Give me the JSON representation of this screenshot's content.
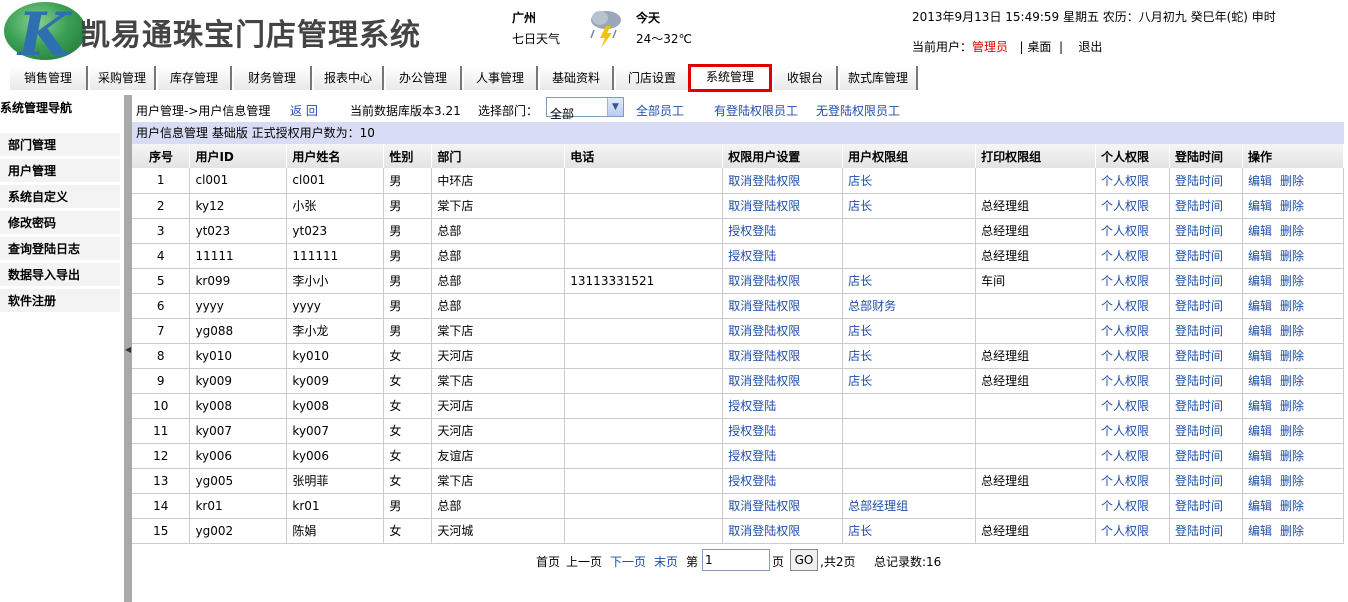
{
  "header": {
    "logo_letter": "K",
    "app_title": "凯易通珠宝门店管理系统",
    "city": "广州",
    "city_sub": "七日天气",
    "weather_icon": "thunderstorm-icon",
    "today_label": "今天",
    "temperature": "24～32℃",
    "datetime": "2013年9月13日  15:49:59 星期五  农历：八月初九  癸巳年(蛇) 申时",
    "current_user_label": "当前用户：",
    "current_user": "管理员",
    "sep1": "|",
    "desktop_link": "桌面",
    "sep2": "|",
    "logout_link": "退出",
    "brand_color": "#2e6fb0",
    "user_color": "#dd0000"
  },
  "nav": {
    "items": [
      {
        "label": "销售管理"
      },
      {
        "label": "采购管理"
      },
      {
        "label": "库存管理"
      },
      {
        "label": "财务管理"
      },
      {
        "label": "报表中心"
      },
      {
        "label": "办公管理"
      },
      {
        "label": "人事管理"
      },
      {
        "label": "基础资料"
      },
      {
        "label": "门店设置"
      },
      {
        "label": "系统管理"
      },
      {
        "label": "收银台"
      },
      {
        "label": "款式库管理"
      }
    ],
    "active_index": 9,
    "active_color": "#e00000"
  },
  "sidebar": {
    "title": "系统管理导航",
    "items": [
      {
        "label": "部门管理"
      },
      {
        "label": "用户管理"
      },
      {
        "label": "系统自定义"
      },
      {
        "label": "修改密码"
      },
      {
        "label": "查询登陆日志"
      },
      {
        "label": "数据导入导出"
      },
      {
        "label": "软件注册"
      }
    ]
  },
  "toolbar": {
    "breadcrumb": "用户管理->用户信息管理",
    "back_link": "返 回",
    "db_version": "当前数据库版本3.21",
    "dept_label": "选择部门：",
    "dept_value": "全部",
    "all_staff": "全部员工",
    "with_login": "有登陆权限员工",
    "without_login": "无登陆权限员工"
  },
  "infobar": {
    "text": "用户信息管理   基础版  正式授权用户数为：10",
    "bg_color": "#d9dcf5"
  },
  "table": {
    "headers": [
      "序号",
      "用户ID",
      "用户姓名",
      "性别",
      "部门",
      "电话",
      "权限用户设置",
      "用户权限组",
      "打印权限组",
      "个人权限",
      "登陆时间",
      "操作"
    ],
    "personal_link": "个人权限",
    "login_link": "登陆时间",
    "edit_link": "编辑",
    "delete_link": "删除",
    "rows": [
      {
        "no": "1",
        "id": "cl001",
        "name": "cl001",
        "gender": "男",
        "dept": "中环店",
        "phone": "",
        "perm": "取消登陆权限",
        "group": "店长",
        "print": ""
      },
      {
        "no": "2",
        "id": "ky12",
        "name": "小张",
        "gender": "男",
        "dept": "棠下店",
        "phone": "",
        "perm": "取消登陆权限",
        "group": "店长",
        "print": "总经理组"
      },
      {
        "no": "3",
        "id": "yt023",
        "name": "yt023",
        "gender": "男",
        "dept": "总部",
        "phone": "",
        "perm": "授权登陆",
        "group": "",
        "print": "总经理组"
      },
      {
        "no": "4",
        "id": "11111",
        "name": "111111",
        "gender": "男",
        "dept": "总部",
        "phone": "",
        "perm": "授权登陆",
        "group": "",
        "print": "总经理组"
      },
      {
        "no": "5",
        "id": "kr099",
        "name": "李小小",
        "gender": "男",
        "dept": "总部",
        "phone": "13113331521",
        "perm": "取消登陆权限",
        "group": "店长",
        "print": "车间"
      },
      {
        "no": "6",
        "id": "yyyy",
        "name": "yyyy",
        "gender": "男",
        "dept": "总部",
        "phone": "",
        "perm": "取消登陆权限",
        "group": "总部财务",
        "print": ""
      },
      {
        "no": "7",
        "id": "yg088",
        "name": "李小龙",
        "gender": "男",
        "dept": "棠下店",
        "phone": "",
        "perm": "取消登陆权限",
        "group": "店长",
        "print": ""
      },
      {
        "no": "8",
        "id": "ky010",
        "name": "ky010",
        "gender": "女",
        "dept": "天河店",
        "phone": "",
        "perm": "取消登陆权限",
        "group": "店长",
        "print": "总经理组"
      },
      {
        "no": "9",
        "id": "ky009",
        "name": "ky009",
        "gender": "女",
        "dept": "棠下店",
        "phone": "",
        "perm": "取消登陆权限",
        "group": "店长",
        "print": "总经理组"
      },
      {
        "no": "10",
        "id": "ky008",
        "name": "ky008",
        "gender": "女",
        "dept": "天河店",
        "phone": "",
        "perm": "授权登陆",
        "group": "",
        "print": ""
      },
      {
        "no": "11",
        "id": "ky007",
        "name": "ky007",
        "gender": "女",
        "dept": "天河店",
        "phone": "",
        "perm": "授权登陆",
        "group": "",
        "print": ""
      },
      {
        "no": "12",
        "id": "ky006",
        "name": "ky006",
        "gender": "女",
        "dept": "友谊店",
        "phone": "",
        "perm": "授权登陆",
        "group": "",
        "print": ""
      },
      {
        "no": "13",
        "id": "yg005",
        "name": "张明菲",
        "gender": "女",
        "dept": "棠下店",
        "phone": "",
        "perm": "授权登陆",
        "group": "",
        "print": "总经理组"
      },
      {
        "no": "14",
        "id": "kr01",
        "name": "kr01",
        "gender": "男",
        "dept": "总部",
        "phone": "",
        "perm": "取消登陆权限",
        "group": "总部经理组",
        "print": ""
      },
      {
        "no": "15",
        "id": "yg002",
        "name": "陈娟",
        "gender": "女",
        "dept": "天河城",
        "phone": "",
        "perm": "取消登陆权限",
        "group": "店长",
        "print": "总经理组"
      }
    ]
  },
  "pager": {
    "first": "首页",
    "prev": "上一页",
    "next": "下一页",
    "last": "末页",
    "page_label": "第",
    "page_value": "1",
    "page_unit": "页",
    "go": "GO",
    "total_pages": ",共2页",
    "total_records": "总记录数:16"
  }
}
